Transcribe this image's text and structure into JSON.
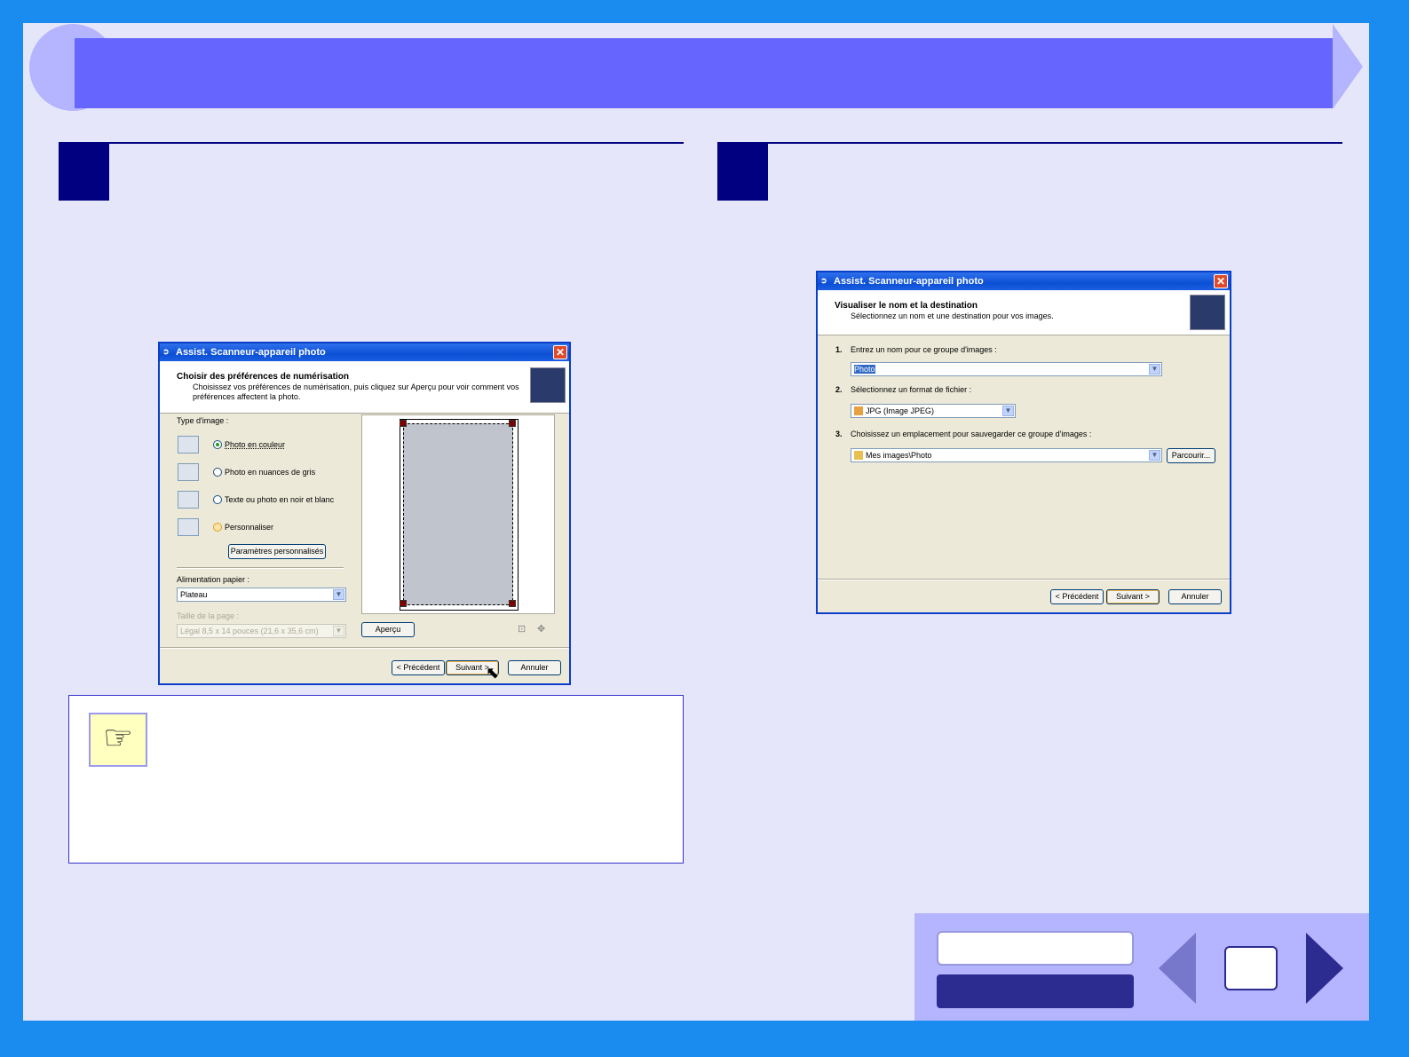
{
  "colors": {
    "frame": "#1a8cf0",
    "page": "#e6e6fa",
    "banner": "#6666ff",
    "step": "#000080",
    "nav_dark": "#2b2b90"
  },
  "dialog_left": {
    "title": "Assist. Scanneur-appareil photo",
    "header_title": "Choisir des préférences de numérisation",
    "header_desc_line1": "Choisissez vos préférences de numérisation, puis cliquez sur Aperçu pour voir comment vos",
    "header_desc_line2": "préférences affectent la photo.",
    "image_type_label": "Type d'image :",
    "options": [
      {
        "label": "Photo en couleur",
        "selected": true
      },
      {
        "label": "Photo en nuances de gris",
        "selected": false
      },
      {
        "label": "Texte ou photo en noir et blanc",
        "selected": false
      },
      {
        "label": "Personnaliser",
        "selected": false
      }
    ],
    "custom_settings_button": "Paramètres personnalisés",
    "paper_feed_label": "Alimentation papier :",
    "paper_feed_value": "Plateau",
    "page_size_label": "Taille de la page :",
    "page_size_value": "Légal 8,5 x 14 pouces (21,6 x 35,6 cm)",
    "preview_button": "Aperçu",
    "back_button": "< Précédent",
    "next_button": "Suivant >",
    "cancel_button": "Annuler"
  },
  "dialog_right": {
    "title": "Assist. Scanneur-appareil photo",
    "header_title": "Visualiser le nom et la destination",
    "header_desc": "Sélectionnez un nom et une destination pour vos images.",
    "step1_label": "1.",
    "step1_text": "Entrez un nom pour ce groupe d'images :",
    "step1_value": "Photo",
    "step2_label": "2.",
    "step2_text": "Sélectionnez un format de fichier :",
    "step2_value": "JPG (Image JPEG)",
    "step3_label": "3.",
    "step3_text": "Choisissez un emplacement pour sauvegarder ce groupe d'images :",
    "step3_value": "Mes images\\Photo",
    "browse_button": "Parcourir...",
    "back_button": "< Précédent",
    "next_button": "Suivant >",
    "cancel_button": "Annuler"
  },
  "icons": {
    "note": "pointing-hand-icon",
    "prev": "prev-arrow-icon",
    "next": "next-arrow-icon"
  }
}
